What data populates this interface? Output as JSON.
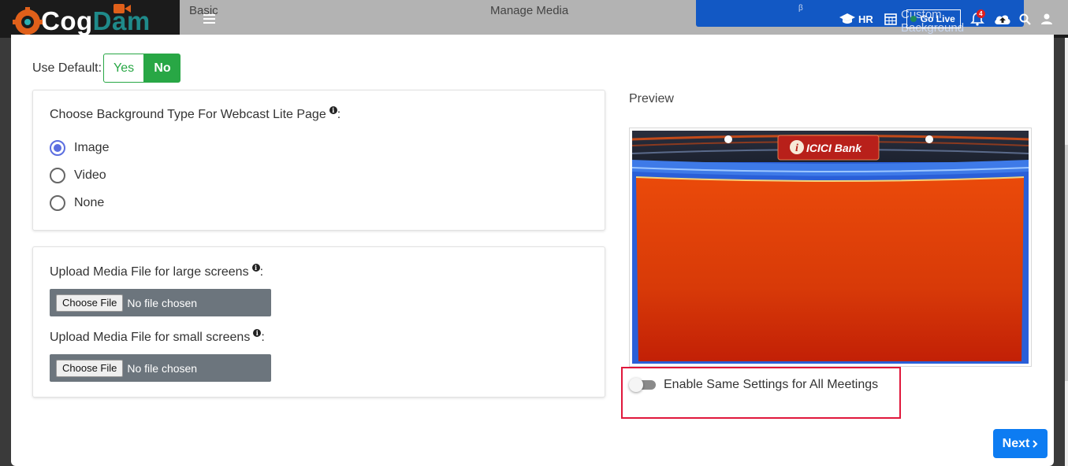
{
  "brand": {
    "cog": "Cog",
    "dam": "Dam"
  },
  "tabs": {
    "basic": "Basic",
    "manage_media": "Manage Media",
    "custom_background": "Custom Background",
    "custom_background_sup": "β"
  },
  "header": {
    "hr_label": "HR",
    "go_live_label": "Go Live",
    "notification_count": "4"
  },
  "use_default": {
    "label": "Use Default:",
    "yes": "Yes",
    "no": "No",
    "selected": "No"
  },
  "background_type": {
    "title": "Choose Background Type For Webcast Lite Page",
    "title_suffix": ":",
    "options": [
      "Image",
      "Video",
      "None"
    ],
    "selected": "Image"
  },
  "uploads": {
    "large": {
      "label": "Upload Media File for large screens",
      "suffix": ":",
      "button": "Choose File",
      "status": "No file chosen"
    },
    "small": {
      "label": "Upload Media File for small screens",
      "suffix": ":",
      "button": "Choose File",
      "status": "No file chosen"
    }
  },
  "preview": {
    "label": "Preview",
    "logo_text": "ICICI Bank"
  },
  "toggle": {
    "label": "Enable Same Settings for All Meetings",
    "enabled": false
  },
  "next_button": {
    "label": "Next",
    "icon": "chevron-right"
  },
  "colors": {
    "primary_blue": "#0d7cf2",
    "tab_active_blue": "#1258c4",
    "success_green": "#28a745",
    "radio_accent": "#5b6ee0",
    "highlight_red": "#e0183c",
    "preview_orange": "#e0440a"
  }
}
